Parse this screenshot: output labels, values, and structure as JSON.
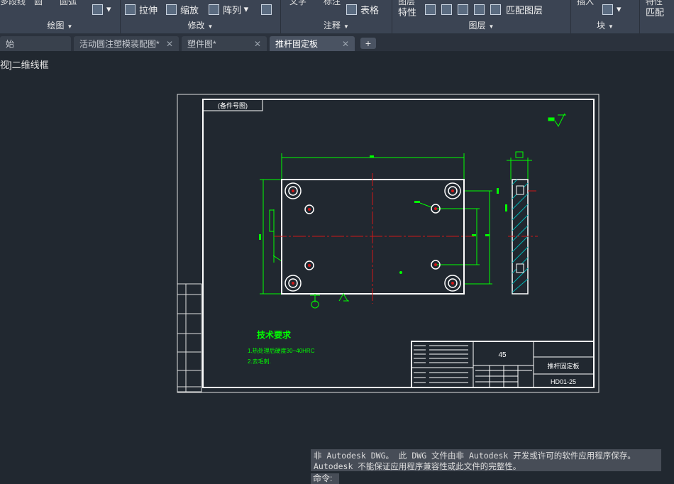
{
  "ribbon": {
    "groups": [
      {
        "title": "绘图"
      },
      {
        "title": "修改"
      },
      {
        "title": "注释"
      },
      {
        "title": "图层"
      },
      {
        "title": "块"
      }
    ],
    "modify": {
      "stretch": "拉伸",
      "scale": "缩放",
      "array": "阵列"
    },
    "annotate": {
      "table": "表格"
    },
    "layers": {
      "properties": "特性",
      "match_layer": "匹配图层"
    },
    "properties": {
      "match": "匹配"
    }
  },
  "tabs": [
    {
      "label": "始",
      "active": false
    },
    {
      "label": "活动圆注塑模装配图*",
      "active": false
    },
    {
      "label": "塑件图*",
      "active": false
    },
    {
      "label": "推杆固定板",
      "active": true
    }
  ],
  "viewport_label": "视]二维线框",
  "drawing": {
    "title_block": {
      "material": "45",
      "part_name": "推杆固定板",
      "part_number": "HD01-25"
    },
    "tech_requirements": {
      "heading": "技术要求",
      "lines": [
        "1.热处理后硬度30~40HRC",
        "2.去毛刺."
      ]
    },
    "stamp": "(备件号图)",
    "dim_length": "180"
  },
  "command": {
    "message_lines": [
      "非 Autodesk DWG。  此 DWG 文件由非 Autodesk 开发或许可的软件应用程序保存。",
      "Autodesk 不能保证应用程序兼容性或此文件的完整性。"
    ],
    "prompt": "命令:"
  }
}
